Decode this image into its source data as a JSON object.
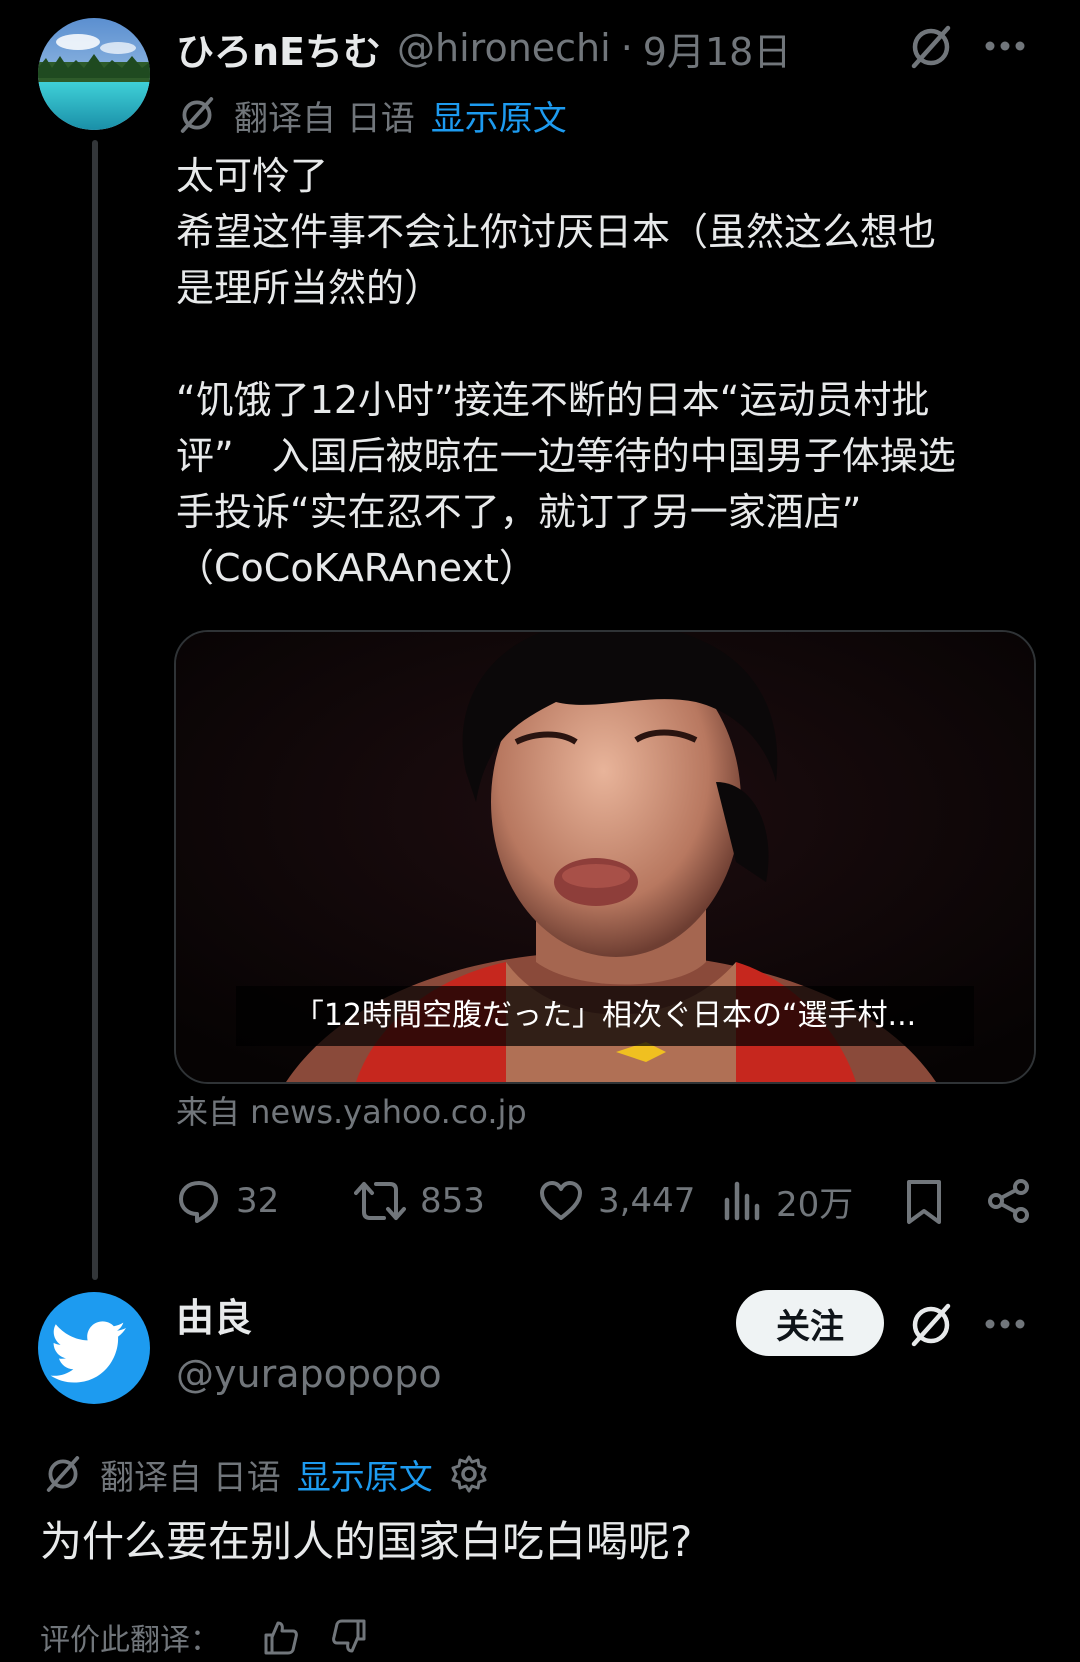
{
  "tweet1": {
    "display_name": "ひろnEちむ",
    "handle": "@hironechi",
    "separator": "·",
    "date": "9月18日",
    "translate_label": "翻译自 日语",
    "show_original": "显示原文",
    "body_line1": "太可怜了",
    "body_line2": "希望这件事不会让你讨厌日本（虽然这么想也",
    "body_line3": "是理所当然的）",
    "quote_line1": "“饥饿了12小时”接连不断的日本“运动员村批",
    "quote_line2": "评”　入国后被晾在一边等待的中国男子体操选",
    "quote_line3": "手投诉“实在忍不了，就订了另一家酒店”",
    "quote_line4": "（CoCoKARAnext）",
    "card_caption": "「12時間空腹だった」相次ぐ日本の“選手村...",
    "source": "来自 news.yahoo.co.jp",
    "replies": "32",
    "retweets": "853",
    "likes": "3,447",
    "views": "20万"
  },
  "tweet2": {
    "display_name": "由良",
    "handle": "@yurapopopo",
    "follow_label": "关注",
    "translate_label": "翻译自 日语",
    "show_original": "显示原文",
    "body": "为什么要在别人的国家白吃白喝呢?",
    "rate_label": "评价此翻译："
  },
  "icons": [
    "no-translate-icon",
    "more-icon",
    "reply-icon",
    "retweet-icon",
    "like-icon",
    "views-icon",
    "bookmark-icon",
    "share-icon",
    "gear-icon",
    "thumbs-up-icon",
    "thumbs-down-icon",
    "twitter-bird-icon"
  ],
  "colors": {
    "background": "#000000",
    "text": "#e7e9ea",
    "muted": "#71767b",
    "link": "#1d9bf0",
    "avatar_blue": "#1d9bf0"
  }
}
